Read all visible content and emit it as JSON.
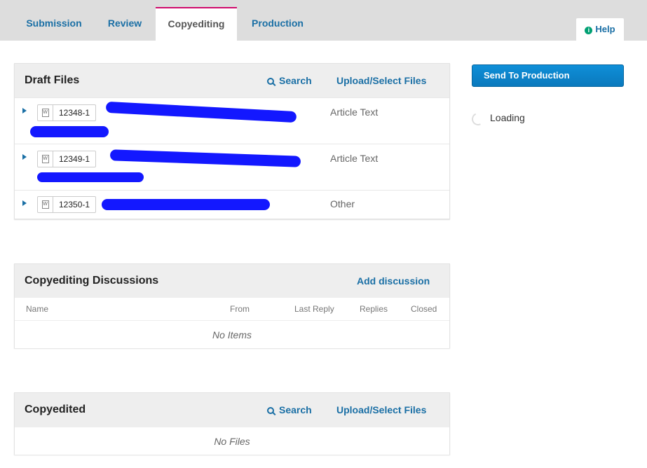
{
  "tabs": [
    {
      "label": "Submission"
    },
    {
      "label": "Review"
    },
    {
      "label": "Copyediting"
    },
    {
      "label": "Production"
    }
  ],
  "help": {
    "label": "Help"
  },
  "draft_files": {
    "title": "Draft Files",
    "search_label": "Search",
    "upload_label": "Upload/Select Files",
    "rows": [
      {
        "id": "12348-1",
        "type": "Article Text"
      },
      {
        "id": "12349-1",
        "type": "Article Text"
      },
      {
        "id": "12350-1",
        "type": "Other"
      }
    ]
  },
  "discussions": {
    "title": "Copyediting Discussions",
    "add_label": "Add discussion",
    "columns": [
      "Name",
      "From",
      "Last Reply",
      "Replies",
      "Closed"
    ],
    "empty_text": "No Items"
  },
  "copyedited": {
    "title": "Copyedited",
    "search_label": "Search",
    "upload_label": "Upload/Select Files",
    "empty_text": "No Files"
  },
  "sidebar": {
    "send_button": "Send To Production",
    "loading_text": "Loading"
  }
}
